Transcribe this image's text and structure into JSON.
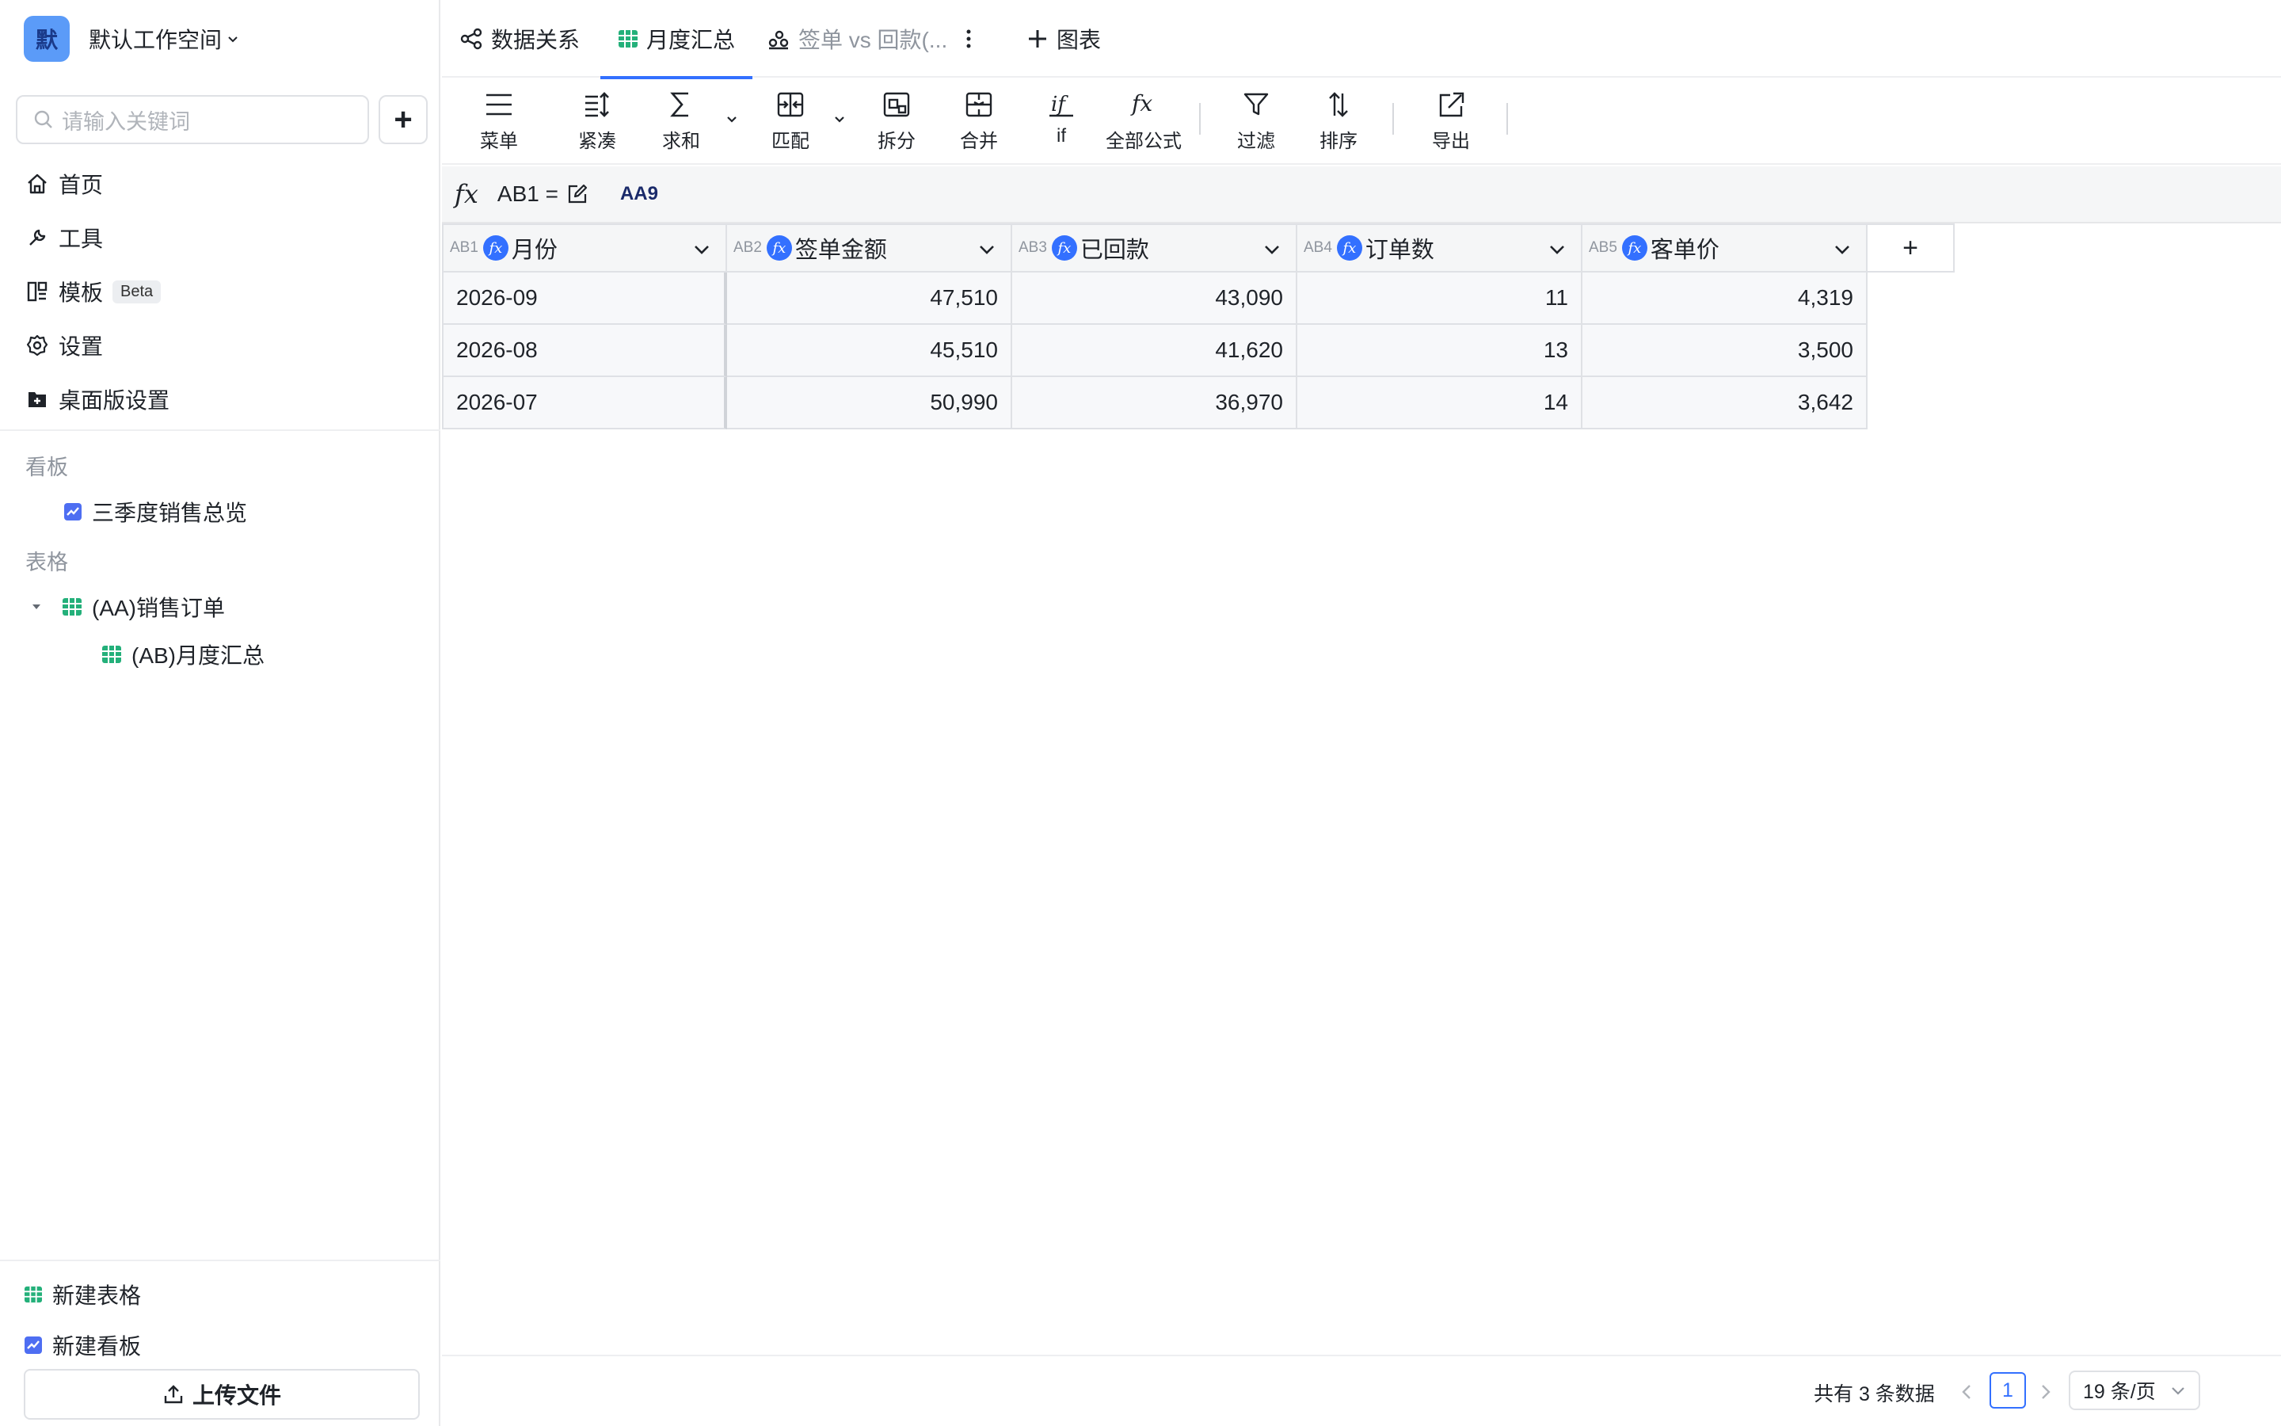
{
  "workspace": {
    "avatar": "默",
    "name": "默认工作空间"
  },
  "search": {
    "placeholder": "请输入关键词",
    "add_label": "+"
  },
  "nav": [
    {
      "label": "首页",
      "icon": "home-icon"
    },
    {
      "label": "工具",
      "icon": "wrench-icon"
    },
    {
      "label": "模板",
      "icon": "template-icon",
      "badge": "Beta"
    },
    {
      "label": "设置",
      "icon": "gear-icon"
    },
    {
      "label": "桌面版设置",
      "icon": "desktop-settings-icon"
    }
  ],
  "groups": {
    "boards_title": "看板",
    "boards": [
      {
        "label": "三季度销售总览"
      }
    ],
    "tables_title": "表格",
    "tables": [
      {
        "label": "(AA)销售订单",
        "expanded": true
      },
      {
        "label": "(AB)月度汇总"
      }
    ]
  },
  "bottom": {
    "new_table": "新建表格",
    "new_board": "新建看板",
    "upload": "上传文件"
  },
  "tabs": [
    {
      "label": "数据关系",
      "icon": "share-icon"
    },
    {
      "label": "月度汇总",
      "icon": "table-icon",
      "active": true
    },
    {
      "label": "签单 vs 回款(...",
      "icon": "chart-icon",
      "muted": true
    }
  ],
  "add_chart_label": "图表",
  "toolbar": {
    "menu": "菜单",
    "compact": "紧凑",
    "sum": "求和",
    "match": "匹配",
    "split": "拆分",
    "merge": "合并",
    "if": "if",
    "all_formula": "全部公式",
    "filter": "过滤",
    "sort": "排序",
    "export": "导出"
  },
  "formula_bar": {
    "fx": "fx",
    "cell_ref": "AB1 =",
    "value": "AA9"
  },
  "table": {
    "columns": [
      {
        "code": "AB1",
        "name": "月份"
      },
      {
        "code": "AB2",
        "name": "签单金额"
      },
      {
        "code": "AB3",
        "name": "已回款"
      },
      {
        "code": "AB4",
        "name": "订单数"
      },
      {
        "code": "AB5",
        "name": "客单价"
      }
    ],
    "add_column": "+",
    "rows": [
      [
        "2026-09",
        "47,510",
        "43,090",
        "11",
        "4,319"
      ],
      [
        "2026-08",
        "45,510",
        "41,620",
        "13",
        "3,500"
      ],
      [
        "2026-07",
        "50,990",
        "36,970",
        "14",
        "3,642"
      ]
    ]
  },
  "pagination": {
    "total": "共有 3 条数据",
    "current": "1",
    "page_size": "19 条/页"
  },
  "colors": {
    "accent": "#3370ff",
    "board_icon": "#4e6ef2",
    "table_icon": "#24b07a"
  }
}
